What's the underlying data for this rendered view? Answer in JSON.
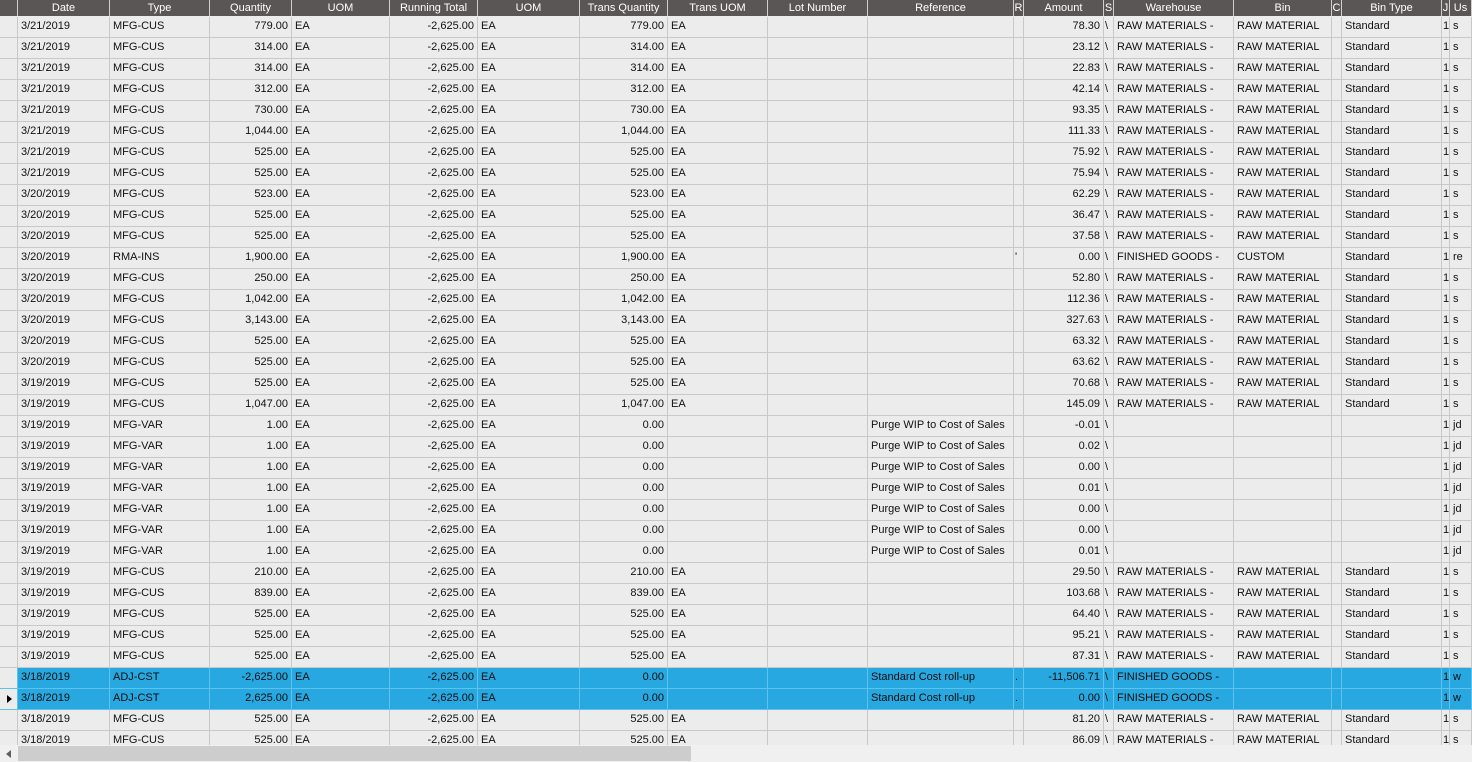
{
  "columns": [
    "Date",
    "Type",
    "Quantity",
    "UOM",
    "Running Total",
    "UOM",
    "Trans Quantity",
    "Trans UOM",
    "Lot Number",
    "Reference",
    "R",
    "Amount",
    "S",
    "Warehouse",
    "Bin",
    "C",
    "Bin Type",
    "J",
    "Us"
  ],
  "rows": [
    {
      "date": "3/21/2019",
      "type": "MFG-CUS",
      "qty": "779.00",
      "uom": "EA",
      "running": "-2,625.00",
      "uom2": "EA",
      "tqty": "779.00",
      "tuom": "EA",
      "lot": "",
      "ref": "",
      "r": "",
      "amount": "78.30",
      "s": "\\",
      "wh": "RAW MATERIALS -",
      "bin": "RAW MATERIAL",
      "c": "",
      "bintype": "Standard",
      "j": "1",
      "us": "s"
    },
    {
      "date": "3/21/2019",
      "type": "MFG-CUS",
      "qty": "314.00",
      "uom": "EA",
      "running": "-2,625.00",
      "uom2": "EA",
      "tqty": "314.00",
      "tuom": "EA",
      "lot": "",
      "ref": "",
      "r": "",
      "amount": "23.12",
      "s": "\\",
      "wh": "RAW MATERIALS -",
      "bin": "RAW MATERIAL",
      "c": "",
      "bintype": "Standard",
      "j": "1",
      "us": "s"
    },
    {
      "date": "3/21/2019",
      "type": "MFG-CUS",
      "qty": "314.00",
      "uom": "EA",
      "running": "-2,625.00",
      "uom2": "EA",
      "tqty": "314.00",
      "tuom": "EA",
      "lot": "",
      "ref": "",
      "r": "",
      "amount": "22.83",
      "s": "\\",
      "wh": "RAW MATERIALS -",
      "bin": "RAW MATERIAL",
      "c": "",
      "bintype": "Standard",
      "j": "1",
      "us": "s"
    },
    {
      "date": "3/21/2019",
      "type": "MFG-CUS",
      "qty": "312.00",
      "uom": "EA",
      "running": "-2,625.00",
      "uom2": "EA",
      "tqty": "312.00",
      "tuom": "EA",
      "lot": "",
      "ref": "",
      "r": "",
      "amount": "42.14",
      "s": "\\",
      "wh": "RAW MATERIALS -",
      "bin": "RAW MATERIAL",
      "c": "",
      "bintype": "Standard",
      "j": "1",
      "us": "s"
    },
    {
      "date": "3/21/2019",
      "type": "MFG-CUS",
      "qty": "730.00",
      "uom": "EA",
      "running": "-2,625.00",
      "uom2": "EA",
      "tqty": "730.00",
      "tuom": "EA",
      "lot": "",
      "ref": "",
      "r": "",
      "amount": "93.35",
      "s": "\\",
      "wh": "RAW MATERIALS -",
      "bin": "RAW MATERIAL",
      "c": "",
      "bintype": "Standard",
      "j": "1",
      "us": "s"
    },
    {
      "date": "3/21/2019",
      "type": "MFG-CUS",
      "qty": "1,044.00",
      "uom": "EA",
      "running": "-2,625.00",
      "uom2": "EA",
      "tqty": "1,044.00",
      "tuom": "EA",
      "lot": "",
      "ref": "",
      "r": "",
      "amount": "111.33",
      "s": "\\",
      "wh": "RAW MATERIALS -",
      "bin": "RAW MATERIAL",
      "c": "",
      "bintype": "Standard",
      "j": "1",
      "us": "s"
    },
    {
      "date": "3/21/2019",
      "type": "MFG-CUS",
      "qty": "525.00",
      "uom": "EA",
      "running": "-2,625.00",
      "uom2": "EA",
      "tqty": "525.00",
      "tuom": "EA",
      "lot": "",
      "ref": "",
      "r": "",
      "amount": "75.92",
      "s": "\\",
      "wh": "RAW MATERIALS -",
      "bin": "RAW MATERIAL",
      "c": "",
      "bintype": "Standard",
      "j": "1",
      "us": "s"
    },
    {
      "date": "3/21/2019",
      "type": "MFG-CUS",
      "qty": "525.00",
      "uom": "EA",
      "running": "-2,625.00",
      "uom2": "EA",
      "tqty": "525.00",
      "tuom": "EA",
      "lot": "",
      "ref": "",
      "r": "",
      "amount": "75.94",
      "s": "\\",
      "wh": "RAW MATERIALS -",
      "bin": "RAW MATERIAL",
      "c": "",
      "bintype": "Standard",
      "j": "1",
      "us": "s"
    },
    {
      "date": "3/20/2019",
      "type": "MFG-CUS",
      "qty": "523.00",
      "uom": "EA",
      "running": "-2,625.00",
      "uom2": "EA",
      "tqty": "523.00",
      "tuom": "EA",
      "lot": "",
      "ref": "",
      "r": "",
      "amount": "62.29",
      "s": "\\",
      "wh": "RAW MATERIALS -",
      "bin": "RAW MATERIAL",
      "c": "",
      "bintype": "Standard",
      "j": "1",
      "us": "s"
    },
    {
      "date": "3/20/2019",
      "type": "MFG-CUS",
      "qty": "525.00",
      "uom": "EA",
      "running": "-2,625.00",
      "uom2": "EA",
      "tqty": "525.00",
      "tuom": "EA",
      "lot": "",
      "ref": "",
      "r": "",
      "amount": "36.47",
      "s": "\\",
      "wh": "RAW MATERIALS -",
      "bin": "RAW MATERIAL",
      "c": "",
      "bintype": "Standard",
      "j": "1",
      "us": "s"
    },
    {
      "date": "3/20/2019",
      "type": "MFG-CUS",
      "qty": "525.00",
      "uom": "EA",
      "running": "-2,625.00",
      "uom2": "EA",
      "tqty": "525.00",
      "tuom": "EA",
      "lot": "",
      "ref": "",
      "r": "",
      "amount": "37.58",
      "s": "\\",
      "wh": "RAW MATERIALS -",
      "bin": "RAW MATERIAL",
      "c": "",
      "bintype": "Standard",
      "j": "1",
      "us": "s"
    },
    {
      "date": "3/20/2019",
      "type": "RMA-INS",
      "qty": "1,900.00",
      "uom": "EA",
      "running": "-2,625.00",
      "uom2": "EA",
      "tqty": "1,900.00",
      "tuom": "EA",
      "lot": "",
      "ref": "",
      "r": "'",
      "amount": "0.00",
      "s": "\\",
      "wh": "FINISHED GOODS -",
      "bin": "CUSTOM",
      "c": "",
      "bintype": "Standard",
      "j": "1",
      "us": "re"
    },
    {
      "date": "3/20/2019",
      "type": "MFG-CUS",
      "qty": "250.00",
      "uom": "EA",
      "running": "-2,625.00",
      "uom2": "EA",
      "tqty": "250.00",
      "tuom": "EA",
      "lot": "",
      "ref": "",
      "r": "",
      "amount": "52.80",
      "s": "\\",
      "wh": "RAW MATERIALS -",
      "bin": "RAW MATERIAL",
      "c": "",
      "bintype": "Standard",
      "j": "1",
      "us": "s"
    },
    {
      "date": "3/20/2019",
      "type": "MFG-CUS",
      "qty": "1,042.00",
      "uom": "EA",
      "running": "-2,625.00",
      "uom2": "EA",
      "tqty": "1,042.00",
      "tuom": "EA",
      "lot": "",
      "ref": "",
      "r": "",
      "amount": "112.36",
      "s": "\\",
      "wh": "RAW MATERIALS -",
      "bin": "RAW MATERIAL",
      "c": "",
      "bintype": "Standard",
      "j": "1",
      "us": "s"
    },
    {
      "date": "3/20/2019",
      "type": "MFG-CUS",
      "qty": "3,143.00",
      "uom": "EA",
      "running": "-2,625.00",
      "uom2": "EA",
      "tqty": "3,143.00",
      "tuom": "EA",
      "lot": "",
      "ref": "",
      "r": "",
      "amount": "327.63",
      "s": "\\",
      "wh": "RAW MATERIALS -",
      "bin": "RAW MATERIAL",
      "c": "",
      "bintype": "Standard",
      "j": "1",
      "us": "s"
    },
    {
      "date": "3/20/2019",
      "type": "MFG-CUS",
      "qty": "525.00",
      "uom": "EA",
      "running": "-2,625.00",
      "uom2": "EA",
      "tqty": "525.00",
      "tuom": "EA",
      "lot": "",
      "ref": "",
      "r": "",
      "amount": "63.32",
      "s": "\\",
      "wh": "RAW MATERIALS -",
      "bin": "RAW MATERIAL",
      "c": "",
      "bintype": "Standard",
      "j": "1",
      "us": "s"
    },
    {
      "date": "3/20/2019",
      "type": "MFG-CUS",
      "qty": "525.00",
      "uom": "EA",
      "running": "-2,625.00",
      "uom2": "EA",
      "tqty": "525.00",
      "tuom": "EA",
      "lot": "",
      "ref": "",
      "r": "",
      "amount": "63.62",
      "s": "\\",
      "wh": "RAW MATERIALS -",
      "bin": "RAW MATERIAL",
      "c": "",
      "bintype": "Standard",
      "j": "1",
      "us": "s"
    },
    {
      "date": "3/19/2019",
      "type": "MFG-CUS",
      "qty": "525.00",
      "uom": "EA",
      "running": "-2,625.00",
      "uom2": "EA",
      "tqty": "525.00",
      "tuom": "EA",
      "lot": "",
      "ref": "",
      "r": "",
      "amount": "70.68",
      "s": "\\",
      "wh": "RAW MATERIALS -",
      "bin": "RAW MATERIAL",
      "c": "",
      "bintype": "Standard",
      "j": "1",
      "us": "s"
    },
    {
      "date": "3/19/2019",
      "type": "MFG-CUS",
      "qty": "1,047.00",
      "uom": "EA",
      "running": "-2,625.00",
      "uom2": "EA",
      "tqty": "1,047.00",
      "tuom": "EA",
      "lot": "",
      "ref": "",
      "r": "",
      "amount": "145.09",
      "s": "\\",
      "wh": "RAW MATERIALS -",
      "bin": "RAW MATERIAL",
      "c": "",
      "bintype": "Standard",
      "j": "1",
      "us": "s"
    },
    {
      "date": "3/19/2019",
      "type": "MFG-VAR",
      "qty": "1.00",
      "uom": "EA",
      "running": "-2,625.00",
      "uom2": "EA",
      "tqty": "0.00",
      "tuom": "",
      "lot": "",
      "ref": "Purge WIP to Cost of Sales",
      "r": "",
      "amount": "-0.01",
      "s": "\\",
      "wh": "",
      "bin": "",
      "c": "",
      "bintype": "",
      "j": "1",
      "us": "jd"
    },
    {
      "date": "3/19/2019",
      "type": "MFG-VAR",
      "qty": "1.00",
      "uom": "EA",
      "running": "-2,625.00",
      "uom2": "EA",
      "tqty": "0.00",
      "tuom": "",
      "lot": "",
      "ref": "Purge WIP to Cost of Sales",
      "r": "",
      "amount": "0.02",
      "s": "\\",
      "wh": "",
      "bin": "",
      "c": "",
      "bintype": "",
      "j": "1",
      "us": "jd"
    },
    {
      "date": "3/19/2019",
      "type": "MFG-VAR",
      "qty": "1.00",
      "uom": "EA",
      "running": "-2,625.00",
      "uom2": "EA",
      "tqty": "0.00",
      "tuom": "",
      "lot": "",
      "ref": "Purge WIP to Cost of Sales",
      "r": "",
      "amount": "0.00",
      "s": "\\",
      "wh": "",
      "bin": "",
      "c": "",
      "bintype": "",
      "j": "1",
      "us": "jd"
    },
    {
      "date": "3/19/2019",
      "type": "MFG-VAR",
      "qty": "1.00",
      "uom": "EA",
      "running": "-2,625.00",
      "uom2": "EA",
      "tqty": "0.00",
      "tuom": "",
      "lot": "",
      "ref": "Purge WIP to Cost of Sales",
      "r": "",
      "amount": "0.01",
      "s": "\\",
      "wh": "",
      "bin": "",
      "c": "",
      "bintype": "",
      "j": "1",
      "us": "jd"
    },
    {
      "date": "3/19/2019",
      "type": "MFG-VAR",
      "qty": "1.00",
      "uom": "EA",
      "running": "-2,625.00",
      "uom2": "EA",
      "tqty": "0.00",
      "tuom": "",
      "lot": "",
      "ref": "Purge WIP to Cost of Sales",
      "r": "",
      "amount": "0.00",
      "s": "\\",
      "wh": "",
      "bin": "",
      "c": "",
      "bintype": "",
      "j": "1",
      "us": "jd"
    },
    {
      "date": "3/19/2019",
      "type": "MFG-VAR",
      "qty": "1.00",
      "uom": "EA",
      "running": "-2,625.00",
      "uom2": "EA",
      "tqty": "0.00",
      "tuom": "",
      "lot": "",
      "ref": "Purge WIP to Cost of Sales",
      "r": "",
      "amount": "0.00",
      "s": "\\",
      "wh": "",
      "bin": "",
      "c": "",
      "bintype": "",
      "j": "1",
      "us": "jd"
    },
    {
      "date": "3/19/2019",
      "type": "MFG-VAR",
      "qty": "1.00",
      "uom": "EA",
      "running": "-2,625.00",
      "uom2": "EA",
      "tqty": "0.00",
      "tuom": "",
      "lot": "",
      "ref": "Purge WIP to Cost of Sales",
      "r": "",
      "amount": "0.01",
      "s": "\\",
      "wh": "",
      "bin": "",
      "c": "",
      "bintype": "",
      "j": "1",
      "us": "jd"
    },
    {
      "date": "3/19/2019",
      "type": "MFG-CUS",
      "qty": "210.00",
      "uom": "EA",
      "running": "-2,625.00",
      "uom2": "EA",
      "tqty": "210.00",
      "tuom": "EA",
      "lot": "",
      "ref": "",
      "r": "",
      "amount": "29.50",
      "s": "\\",
      "wh": "RAW MATERIALS -",
      "bin": "RAW MATERIAL",
      "c": "",
      "bintype": "Standard",
      "j": "1",
      "us": "s"
    },
    {
      "date": "3/19/2019",
      "type": "MFG-CUS",
      "qty": "839.00",
      "uom": "EA",
      "running": "-2,625.00",
      "uom2": "EA",
      "tqty": "839.00",
      "tuom": "EA",
      "lot": "",
      "ref": "",
      "r": "",
      "amount": "103.68",
      "s": "\\",
      "wh": "RAW MATERIALS -",
      "bin": "RAW MATERIAL",
      "c": "",
      "bintype": "Standard",
      "j": "1",
      "us": "s"
    },
    {
      "date": "3/19/2019",
      "type": "MFG-CUS",
      "qty": "525.00",
      "uom": "EA",
      "running": "-2,625.00",
      "uom2": "EA",
      "tqty": "525.00",
      "tuom": "EA",
      "lot": "",
      "ref": "",
      "r": "",
      "amount": "64.40",
      "s": "\\",
      "wh": "RAW MATERIALS -",
      "bin": "RAW MATERIAL",
      "c": "",
      "bintype": "Standard",
      "j": "1",
      "us": "s"
    },
    {
      "date": "3/19/2019",
      "type": "MFG-CUS",
      "qty": "525.00",
      "uom": "EA",
      "running": "-2,625.00",
      "uom2": "EA",
      "tqty": "525.00",
      "tuom": "EA",
      "lot": "",
      "ref": "",
      "r": "",
      "amount": "95.21",
      "s": "\\",
      "wh": "RAW MATERIALS -",
      "bin": "RAW MATERIAL",
      "c": "",
      "bintype": "Standard",
      "j": "1",
      "us": "s"
    },
    {
      "date": "3/19/2019",
      "type": "MFG-CUS",
      "qty": "525.00",
      "uom": "EA",
      "running": "-2,625.00",
      "uom2": "EA",
      "tqty": "525.00",
      "tuom": "EA",
      "lot": "",
      "ref": "",
      "r": "",
      "amount": "87.31",
      "s": "\\",
      "wh": "RAW MATERIALS -",
      "bin": "RAW MATERIAL",
      "c": "",
      "bintype": "Standard",
      "j": "1",
      "us": "s"
    },
    {
      "date": "3/18/2019",
      "type": "ADJ-CST",
      "qty": "-2,625.00",
      "uom": "EA",
      "running": "-2,625.00",
      "uom2": "EA",
      "tqty": "0.00",
      "tuom": "",
      "lot": "",
      "ref": "Standard Cost roll-up",
      "r": ".",
      "amount": "-11,506.71",
      "s": "\\",
      "wh": "FINISHED GOODS -",
      "bin": "",
      "c": "",
      "bintype": "",
      "j": "1",
      "us": "w",
      "selected": true
    },
    {
      "date": "3/18/2019",
      "type": "ADJ-CST",
      "qty": "2,625.00",
      "uom": "EA",
      "running": "-2,625.00",
      "uom2": "EA",
      "tqty": "0.00",
      "tuom": "",
      "lot": "",
      "ref": "Standard Cost roll-up",
      "r": ".",
      "amount": "0.00",
      "s": "\\",
      "wh": "FINISHED GOODS -",
      "bin": "",
      "c": "",
      "bintype": "",
      "j": "1",
      "us": "w",
      "selected": true,
      "current": true
    },
    {
      "date": "3/18/2019",
      "type": "MFG-CUS",
      "qty": "525.00",
      "uom": "EA",
      "running": "-2,625.00",
      "uom2": "EA",
      "tqty": "525.00",
      "tuom": "EA",
      "lot": "",
      "ref": "",
      "r": "",
      "amount": "81.20",
      "s": "\\",
      "wh": "RAW MATERIALS -",
      "bin": "RAW MATERIAL",
      "c": "",
      "bintype": "Standard",
      "j": "1",
      "us": "s"
    },
    {
      "date": "3/18/2019",
      "type": "MFG-CUS",
      "qty": "525.00",
      "uom": "EA",
      "running": "-2,625.00",
      "uom2": "EA",
      "tqty": "525.00",
      "tuom": "EA",
      "lot": "",
      "ref": "",
      "r": "",
      "amount": "86.09",
      "s": "\\",
      "wh": "RAW MATERIALS -",
      "bin": "RAW MATERIAL",
      "c": "",
      "bintype": "Standard",
      "j": "1",
      "us": "s"
    }
  ],
  "colors": {
    "header_bg": "#5a5655",
    "row_bg": "#ececec",
    "selected_bg": "#27a8e0"
  }
}
